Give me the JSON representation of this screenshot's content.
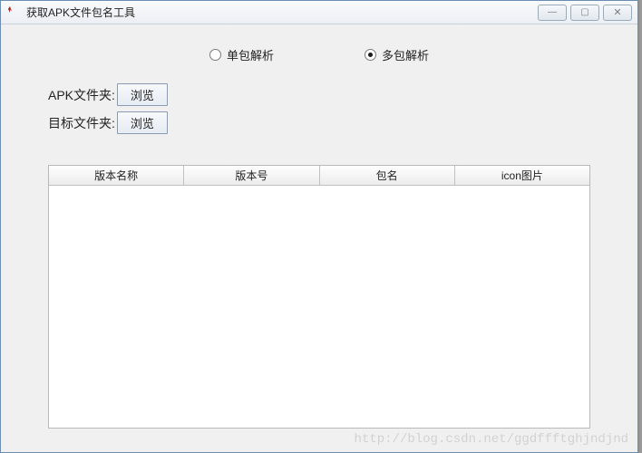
{
  "window": {
    "title": "获取APK文件包名工具",
    "buttons": {
      "min": "—",
      "max": "▢",
      "close": "✕"
    }
  },
  "mode": {
    "single": "单包解析",
    "multi": "多包解析",
    "selected": "multi"
  },
  "fields": {
    "apk_folder_label": "APK文件夹:",
    "target_folder_label": "目标文件夹:",
    "browse_label": "浏览"
  },
  "table": {
    "columns": [
      "版本名称",
      "版本号",
      "包名",
      "icon图片"
    ],
    "rows": []
  },
  "watermark": "http://blog.csdn.net/ggdffftghjndjnd"
}
